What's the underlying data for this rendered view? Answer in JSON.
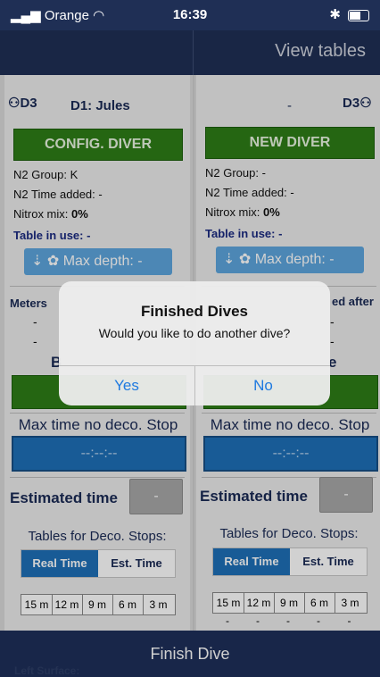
{
  "status": {
    "carrier": "Orange",
    "time": "16:39"
  },
  "header": {
    "view_tables": "View tables"
  },
  "left": {
    "badge": "D3",
    "diver": "D1: Jules",
    "button": "CONFIG. DIVER",
    "n2_group": "N2 Group:  K",
    "n2_time": "N2 Time added: -",
    "nitrox_label": "Nitrox mix: ",
    "nitrox_value": "0%",
    "table_in_use": "Table in use: -",
    "max_depth": "Max depth: -",
    "meters": "Meters",
    "dash": "-",
    "b": "B",
    "nodeco_title": "Max time no deco. Stop",
    "nodeco_value": "--:--:--",
    "estimated": "Estimated time",
    "est_btn": "-",
    "tables_title": "Tables for Deco. Stops:",
    "seg_a": "Real Time",
    "seg_b": "Est. Time",
    "depths": [
      "15 m",
      "12 m",
      "9 m",
      "6 m",
      "3 m"
    ]
  },
  "right": {
    "badge": "D3",
    "dash_top": "-",
    "button": "NEW DIVER",
    "n2_group": "N2 Group:  -",
    "n2_time": "N2 Time added: -",
    "nitrox_label": "Nitrox mix: ",
    "nitrox_value": "0%",
    "table_in_use": "Table in use: -",
    "max_depth": "Max depth: -",
    "meters_after": "ed after",
    "dash": "-",
    "e": "e",
    "nodeco_title": "Max time no deco. Stop",
    "nodeco_value": "--:--:--",
    "estimated": "Estimated time",
    "est_btn": "-",
    "tables_title": "Tables for Deco. Stops:",
    "seg_a": "Real Time",
    "seg_b": "Est. Time",
    "depths": [
      "15 m",
      "12 m",
      "9 m",
      "6 m",
      "3 m"
    ],
    "depth_values": [
      "-",
      "-",
      "-",
      "-",
      "-"
    ]
  },
  "footer": {
    "finish": "Finish Dive",
    "left_surface": "Left Surface:"
  },
  "dialog": {
    "title": "Finished Dives",
    "message": "Would you like to do another dive?",
    "yes": "Yes",
    "no": "No"
  }
}
